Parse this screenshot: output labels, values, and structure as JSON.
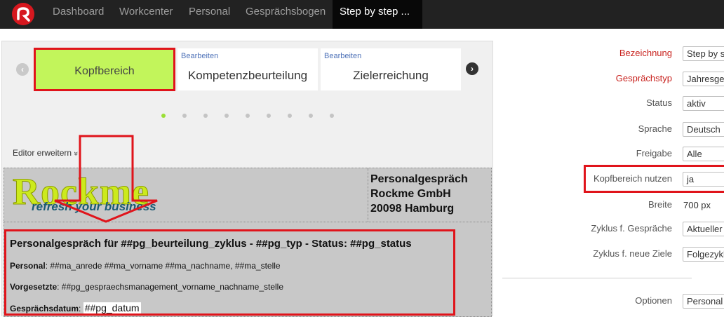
{
  "navbar": {
    "items": [
      "Dashboard",
      "Workcenter",
      "Personal",
      "Gesprächsbogen"
    ],
    "active": "Step by step ..."
  },
  "editor": {
    "cards": [
      {
        "title": "Kopfbereich",
        "edit": ""
      },
      {
        "title": "Kompetenzbeurteilung",
        "edit": "Bearbeiten"
      },
      {
        "title": "Zielerreichung",
        "edit": "Bearbeiten"
      }
    ],
    "expand_label": "Editor erweitern",
    "expand_icon": "»",
    "dots_total": 9,
    "dots_active_index": 0
  },
  "document": {
    "brand": "Rockme",
    "slogan": "refresh your business",
    "address": [
      "Personalgespräch",
      "Rockme GmbH",
      "20098 Hamburg"
    ],
    "title": "Personalgespräch für ##pg_beurteilung_zyklus - ##pg_typ - Status: ##pg_status",
    "personal_label": "Personal",
    "personal_value": ": ##ma_anrede ##ma_vorname ##ma_nachname, ##ma_stelle",
    "vorgesetzte_label": "Vorgesetzte",
    "vorgesetzte_value": ": ##pg_gespraechsmanagement_vorname_nachname_stelle",
    "datum_label": "Gesprächsdatum",
    "datum_sep": ": ",
    "datum_value": "##pg_datum"
  },
  "form": {
    "bezeichnung_label": "Bezeichnung",
    "bezeichnung_value": "Step by s",
    "gespraechstyp_label": "Gesprächstyp",
    "gespraechstyp_value": "Jahresges",
    "status_label": "Status",
    "status_value": "aktiv",
    "sprache_label": "Sprache",
    "sprache_value": "Deutsch",
    "freigabe_label": "Freigabe",
    "freigabe_value": "Alle",
    "kopf_label": "Kopfbereich nutzen",
    "kopf_value": "ja",
    "breite_label": "Breite",
    "breite_value": "700 px",
    "zyklus_label": "Zyklus f. Gespräche",
    "zyklus_value": "Aktueller",
    "ziele_label": "Zyklus f. neue Ziele",
    "ziele_value": "Folgezyklu",
    "optionen_label": "Optionen",
    "optionen_value": "Personal"
  },
  "colors": {
    "navbar": "#222222",
    "active_card": "#c2f55b",
    "highlight": "#e0141b",
    "required_label": "#c8211d",
    "brand": "#ccea1d",
    "slogan": "#1a5a74"
  }
}
